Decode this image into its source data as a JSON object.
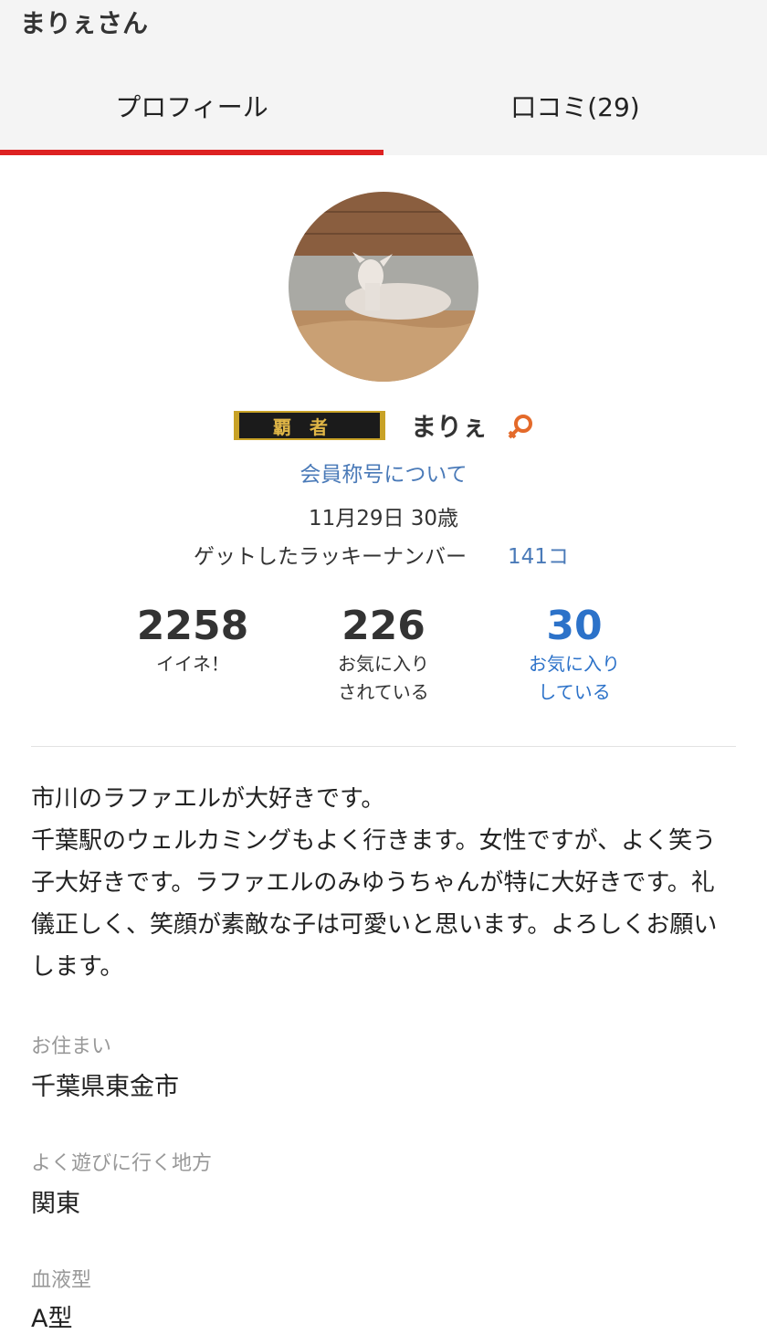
{
  "header": {
    "title": "まりぇさん"
  },
  "tabs": [
    {
      "label": "プロフィール",
      "active": true
    },
    {
      "label": "口コミ(29)",
      "active": false
    }
  ],
  "profile": {
    "rank_badge": "覇者",
    "name": "まりぇ",
    "gender_icon": "female-icon",
    "rank_link": "会員称号について",
    "birthday_age": "11月29日 30歳",
    "lucky_label": "ゲットしたラッキーナンバー",
    "lucky_value": "141コ"
  },
  "stats": [
    {
      "value": "2258",
      "label": "イイネ！"
    },
    {
      "value": "226",
      "label": "お気に入り\nされている"
    },
    {
      "value": "30",
      "label": "お気に入り\nしている"
    }
  ],
  "bio": "市川のラファエルが大好きです。\n千葉駅のウェルカミングもよく行きます。女性ですが、よく笑う子大好きです。ラファエルのみゆうちゃんが特に大好きです。礼儀正しく、笑顔が素敵な子は可愛いと思います。よろしくお願いします。",
  "fields": [
    {
      "label": "お住まい",
      "value": "千葉県東金市"
    },
    {
      "label": "よく遊びに行く地方",
      "value": "関東"
    },
    {
      "label": "血液型",
      "value": "A型"
    }
  ],
  "colors": {
    "accent": "#dd2222",
    "link": "#4a7ab8",
    "stat_link": "#2c72c9"
  }
}
